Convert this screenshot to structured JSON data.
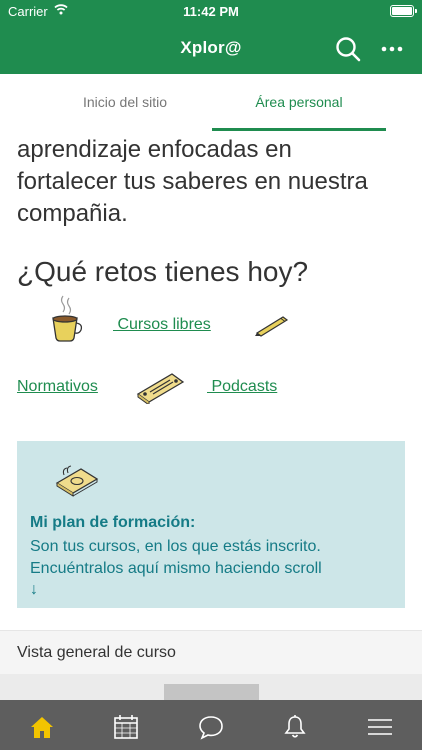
{
  "status_bar": {
    "carrier": "Carrier",
    "time": "11:42 PM"
  },
  "app_bar": {
    "title": "Xplor@"
  },
  "tabs": [
    {
      "label": "Inicio del sitio",
      "active": false
    },
    {
      "label": "Área personal",
      "active": true
    }
  ],
  "content": {
    "intro_lines": [
      "aprendizaje enfocadas en",
      "fortalecer tus saberes en nuestra",
      "compañia."
    ],
    "heading": "¿Qué retos tienes hoy?",
    "links": {
      "cursos_libres": " Cursos libres",
      "normativos": "Normativos",
      "podcasts": " Podcasts"
    },
    "plan": {
      "title": "Mi plan de formación:",
      "body": "Son tus cursos, en los que estás inscrito. Encuéntralos aquí mismo haciendo scroll",
      "arrow": "↓"
    },
    "overview_label": "Vista general de curso"
  },
  "bottom_nav": [
    {
      "icon": "home-icon",
      "active": true
    },
    {
      "icon": "calendar-icon",
      "active": false
    },
    {
      "icon": "chat-icon",
      "active": false
    },
    {
      "icon": "bell-icon",
      "active": false
    },
    {
      "icon": "menu-icon",
      "active": false
    }
  ],
  "colors": {
    "brand_green": "#1f8c4f",
    "plan_background": "#cde6e8",
    "plan_text": "#157b86",
    "bottom_bar": "#5e5e5e",
    "active_nav": "#f2c400"
  }
}
